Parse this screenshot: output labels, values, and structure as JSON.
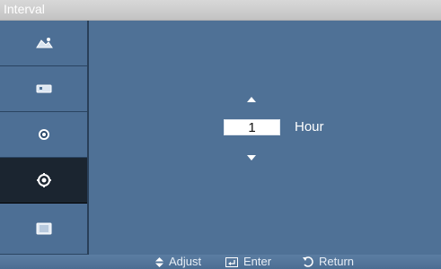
{
  "window": {
    "title": "Interval"
  },
  "sidebar": {
    "items": [
      {
        "icon": "picture-icon"
      },
      {
        "icon": "sound-icon"
      },
      {
        "icon": "setup-icon"
      },
      {
        "icon": "gear-icon"
      },
      {
        "icon": "multi-control-icon"
      }
    ],
    "active_index": 3
  },
  "main": {
    "value": "1",
    "unit": "Hour"
  },
  "footer": {
    "adjust_label": "Adjust",
    "enter_label": "Enter",
    "return_label": "Return"
  },
  "colors": {
    "panel_blue": "#4f7196",
    "sidebar_blue": "#4d6f95",
    "active_item": "#1b2530",
    "title_bar": "#c9c9c9"
  }
}
